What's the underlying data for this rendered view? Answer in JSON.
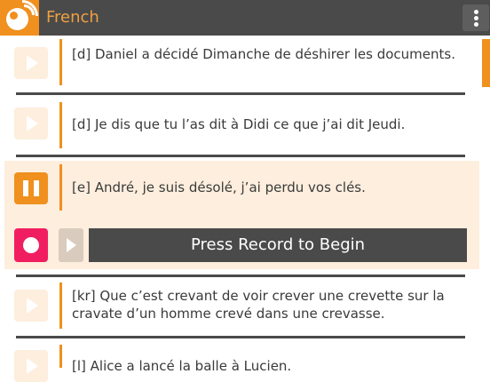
{
  "header": {
    "title": "French",
    "logo_icon": "chatting-logo-icon",
    "menu_icon": "kebab-menu-icon"
  },
  "colors": {
    "accent": "#f0901e",
    "appbar": "#4a4a4a",
    "record": "#f01e60",
    "panel": "#fdeedd"
  },
  "sentences": [
    {
      "text": "[d] Daniel a décidé Dimanche de déshirer les documents."
    },
    {
      "text": "[d] Je dis que tu l’as dit à Didi ce que j’ai dit Jeudi."
    },
    {
      "text": "[e] André, je suis désolé, j’ai perdu vos clés."
    },
    {
      "text": "[kr] Que c’est crevant de voir crever une crevette sur la cravate d’un homme crevé dans une crevasse."
    },
    {
      "text": "[l] Alice a lancé la balle à Lucien."
    }
  ],
  "recorder": {
    "prompt": "Press Record to Begin"
  }
}
